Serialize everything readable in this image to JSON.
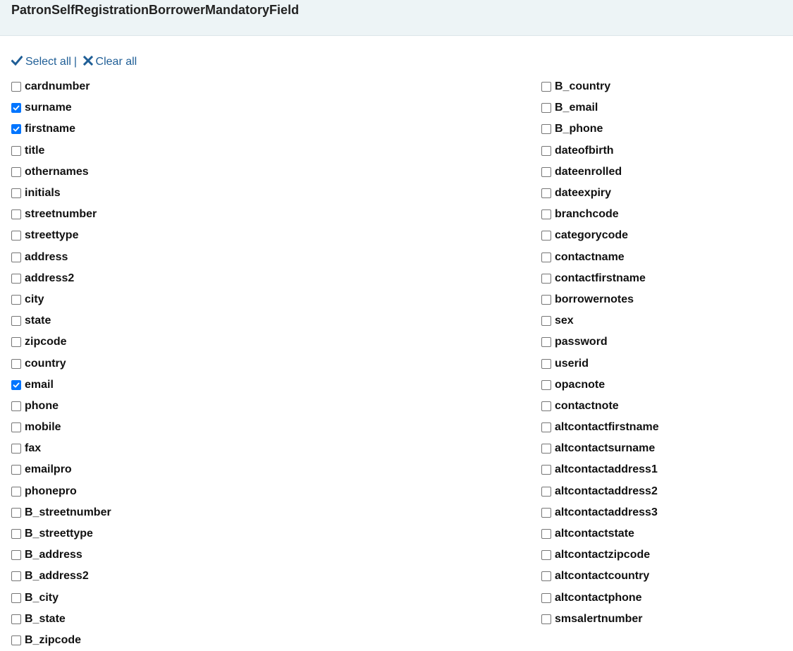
{
  "header": {
    "title": "PatronSelfRegistrationBorrowerMandatoryField"
  },
  "toolbar": {
    "select_all": "Select all",
    "separator": "|",
    "clear_all": "Clear all"
  },
  "colors": {
    "link": "#1f5e96",
    "header_bg": "#edf4f6",
    "checkbox_checked": "#0075ff"
  },
  "fields_left": [
    {
      "name": "cardnumber",
      "checked": false
    },
    {
      "name": "surname",
      "checked": true
    },
    {
      "name": "firstname",
      "checked": true
    },
    {
      "name": "title",
      "checked": false
    },
    {
      "name": "othernames",
      "checked": false
    },
    {
      "name": "initials",
      "checked": false
    },
    {
      "name": "streetnumber",
      "checked": false
    },
    {
      "name": "streettype",
      "checked": false
    },
    {
      "name": "address",
      "checked": false
    },
    {
      "name": "address2",
      "checked": false
    },
    {
      "name": "city",
      "checked": false
    },
    {
      "name": "state",
      "checked": false
    },
    {
      "name": "zipcode",
      "checked": false
    },
    {
      "name": "country",
      "checked": false
    },
    {
      "name": "email",
      "checked": true
    },
    {
      "name": "phone",
      "checked": false
    },
    {
      "name": "mobile",
      "checked": false
    },
    {
      "name": "fax",
      "checked": false
    },
    {
      "name": "emailpro",
      "checked": false
    },
    {
      "name": "phonepro",
      "checked": false
    },
    {
      "name": "B_streetnumber",
      "checked": false
    },
    {
      "name": "B_streettype",
      "checked": false
    },
    {
      "name": "B_address",
      "checked": false
    },
    {
      "name": "B_address2",
      "checked": false
    },
    {
      "name": "B_city",
      "checked": false
    },
    {
      "name": "B_state",
      "checked": false
    },
    {
      "name": "B_zipcode",
      "checked": false
    }
  ],
  "fields_right": [
    {
      "name": "B_country",
      "checked": false
    },
    {
      "name": "B_email",
      "checked": false
    },
    {
      "name": "B_phone",
      "checked": false
    },
    {
      "name": "dateofbirth",
      "checked": false
    },
    {
      "name": "dateenrolled",
      "checked": false
    },
    {
      "name": "dateexpiry",
      "checked": false
    },
    {
      "name": "branchcode",
      "checked": false
    },
    {
      "name": "categorycode",
      "checked": false
    },
    {
      "name": "contactname",
      "checked": false
    },
    {
      "name": "contactfirstname",
      "checked": false
    },
    {
      "name": "borrowernotes",
      "checked": false
    },
    {
      "name": "sex",
      "checked": false
    },
    {
      "name": "password",
      "checked": false
    },
    {
      "name": "userid",
      "checked": false
    },
    {
      "name": "opacnote",
      "checked": false
    },
    {
      "name": "contactnote",
      "checked": false
    },
    {
      "name": "altcontactfirstname",
      "checked": false
    },
    {
      "name": "altcontactsurname",
      "checked": false
    },
    {
      "name": "altcontactaddress1",
      "checked": false
    },
    {
      "name": "altcontactaddress2",
      "checked": false
    },
    {
      "name": "altcontactaddress3",
      "checked": false
    },
    {
      "name": "altcontactstate",
      "checked": false
    },
    {
      "name": "altcontactzipcode",
      "checked": false
    },
    {
      "name": "altcontactcountry",
      "checked": false
    },
    {
      "name": "altcontactphone",
      "checked": false
    },
    {
      "name": "smsalertnumber",
      "checked": false
    }
  ]
}
